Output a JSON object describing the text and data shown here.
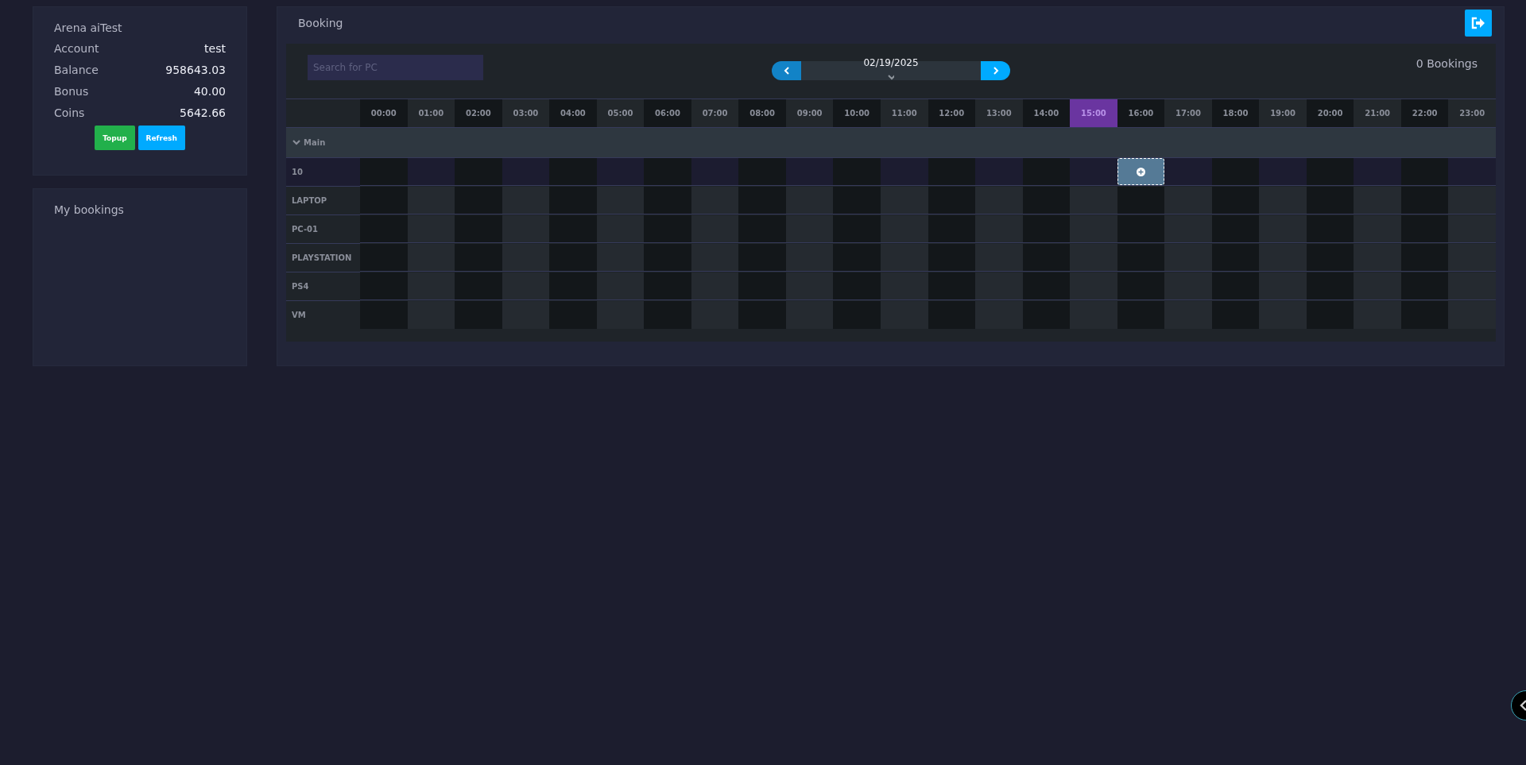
{
  "account_card": {
    "title": "Arena aiTest",
    "rows": [
      {
        "label": "Account",
        "value": "test"
      },
      {
        "label": "Balance",
        "value": "958643.03"
      },
      {
        "label": "Bonus",
        "value": "40.00"
      },
      {
        "label": "Coins",
        "value": "5642.66"
      }
    ],
    "buttons": [
      {
        "label": "Topup",
        "kind": "success"
      },
      {
        "label": "Refresh",
        "kind": "info"
      }
    ]
  },
  "my_bookings": {
    "title": "My bookings"
  },
  "booking": {
    "title": "Booking",
    "search": {
      "placeholder": "Search for PC"
    },
    "date": "02/19/2025",
    "count": "0 Bookings",
    "hours": [
      {
        "label": "00:00",
        "selected": false,
        "hovered": false
      },
      {
        "label": "01:00",
        "selected": false,
        "hovered": false
      },
      {
        "label": "02:00",
        "selected": false,
        "hovered": false
      },
      {
        "label": "03:00",
        "selected": false,
        "hovered": false
      },
      {
        "label": "04:00",
        "selected": false,
        "hovered": false
      },
      {
        "label": "05:00",
        "selected": false,
        "hovered": false
      },
      {
        "label": "06:00",
        "selected": false,
        "hovered": false
      },
      {
        "label": "07:00",
        "selected": false,
        "hovered": false
      },
      {
        "label": "08:00",
        "selected": false,
        "hovered": false
      },
      {
        "label": "09:00",
        "selected": false,
        "hovered": false
      },
      {
        "label": "10:00",
        "selected": false,
        "hovered": false
      },
      {
        "label": "11:00",
        "selected": false,
        "hovered": false
      },
      {
        "label": "12:00",
        "selected": false,
        "hovered": false
      },
      {
        "label": "13:00",
        "selected": false,
        "hovered": false
      },
      {
        "label": "14:00",
        "selected": false,
        "hovered": false
      },
      {
        "label": "15:00",
        "selected": true,
        "hovered": false
      },
      {
        "label": "16:00",
        "selected": false,
        "hovered": true
      },
      {
        "label": "17:00",
        "selected": false,
        "hovered": false
      },
      {
        "label": "18:00",
        "selected": false,
        "hovered": false
      },
      {
        "label": "19:00",
        "selected": false,
        "hovered": false
      },
      {
        "label": "20:00",
        "selected": false,
        "hovered": false
      },
      {
        "label": "21:00",
        "selected": false,
        "hovered": false
      },
      {
        "label": "22:00",
        "selected": false,
        "hovered": false
      },
      {
        "label": "23:00",
        "selected": false,
        "hovered": false
      }
    ],
    "groups": [
      {
        "name": "Main",
        "expanded": true,
        "children": [
          {
            "name": "10",
            "hovered": true
          },
          {
            "name": "LAPTOP",
            "hovered": false
          },
          {
            "name": "PC-01",
            "hovered": false
          },
          {
            "name": "PLAYSTATION",
            "hovered": false
          },
          {
            "name": "PS4",
            "hovered": false
          },
          {
            "name": "VM",
            "hovered": false
          }
        ]
      }
    ]
  }
}
